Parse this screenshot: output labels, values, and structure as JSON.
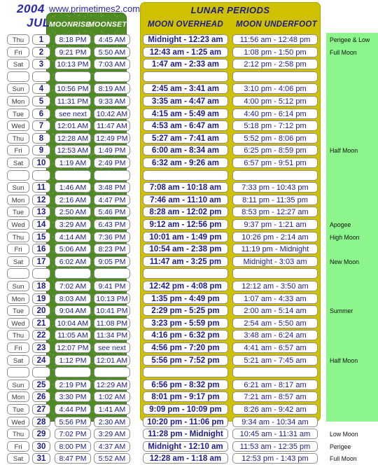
{
  "header": {
    "year": "2004",
    "site": "www.primetimes2.com",
    "month": "JUL",
    "lunar_periods_title": "LUNAR PERIODS",
    "col_moonrise": "MOONRISE",
    "col_moonset": "MOONSET",
    "col_overhead": "MOON OVERHEAD",
    "col_underfoot": "MOON UNDERFOOT"
  },
  "colors": {
    "green_panel": "#4e8b23",
    "yellow_panel": "#cfc100",
    "notes_panel": "#8cf58c",
    "text_blue": "#1c1c8c",
    "title_blue": "#2a2aa8"
  },
  "rows": [
    {
      "dow": "Thu",
      "day": "1",
      "rise": "8:18 PM",
      "set": "4:45 AM",
      "over": "Midnight - 12:23 am",
      "under": "11:56 am - 12:48 pm",
      "note": "Perigee & Low"
    },
    {
      "dow": "Fri",
      "day": "2",
      "rise": "9:21 PM",
      "set": "5:50 AM",
      "over": "12:43 am -  1:25 am",
      "under": "1:08 pm -  1:50 pm",
      "note": "Full Moon"
    },
    {
      "dow": "Sat",
      "day": "3",
      "rise": "10:13 PM",
      "set": "7:03 AM",
      "over": "1:47 am -  2:33 am",
      "under": "2:12 pm -  2:58 pm",
      "note": ""
    },
    {
      "dow": "",
      "day": "",
      "rise": "",
      "set": "",
      "over": "",
      "under": "",
      "note": "",
      "spacer": true
    },
    {
      "dow": "Sun",
      "day": "4",
      "rise": "10:56 PM",
      "set": "8:19 AM",
      "over": "2:45 am -  3:41 am",
      "under": "3:10 pm -  4:06 pm",
      "note": ""
    },
    {
      "dow": "Mon",
      "day": "5",
      "rise": "11:31 PM",
      "set": "9:33 AM",
      "over": "3:35 am -  4:47 am",
      "under": "4:00 pm -  5:12 pm",
      "note": ""
    },
    {
      "dow": "Tue",
      "day": "6",
      "rise": "see next",
      "set": "10:42 AM",
      "over": "4:15 am -  5:49 am",
      "under": "4:40 pm -  6:14 pm",
      "note": ""
    },
    {
      "dow": "Wed",
      "day": "7",
      "rise": "12:01 AM",
      "set": "11:47 AM",
      "over": "4:53 am -  6:47 am",
      "under": "5:18 pm -  7:12 pm",
      "note": ""
    },
    {
      "dow": "Thu",
      "day": "8",
      "rise": "12:28 AM",
      "set": "12:49 PM",
      "over": "5:27 am -  7:41 am",
      "under": "5:52 pm -  8:06 pm",
      "note": ""
    },
    {
      "dow": "Fri",
      "day": "9",
      "rise": "12:53 AM",
      "set": "1:49 PM",
      "over": "6:00 am -  8:34 am",
      "under": "6:25 pm -  8:59 pm",
      "note": "Half Moon"
    },
    {
      "dow": "Sat",
      "day": "10",
      "rise": "1:19 AM",
      "set": "2:49 PM",
      "over": "6:32 am -  9:26 am",
      "under": "6:57 pm -  9:51 pm",
      "note": ""
    },
    {
      "dow": "",
      "day": "",
      "rise": "",
      "set": "",
      "over": "",
      "under": "",
      "note": "",
      "spacer": true
    },
    {
      "dow": "Sun",
      "day": "11",
      "rise": "1:46 AM",
      "set": "3:48 PM",
      "over": "7:08 am - 10:18 am",
      "under": "7:33 pm - 10:43 pm",
      "note": ""
    },
    {
      "dow": "Mon",
      "day": "12",
      "rise": "2:16 AM",
      "set": "4:47 PM",
      "over": "7:46 am - 11:10 am",
      "under": "8:11 pm - 11:35 pm",
      "note": ""
    },
    {
      "dow": "Tue",
      "day": "13",
      "rise": "2:50 AM",
      "set": "5:46 PM",
      "over": "8:28 am - 12:02 pm",
      "under": "8:53 pm - 12:27 am",
      "note": ""
    },
    {
      "dow": "Wed",
      "day": "14",
      "rise": "3:29 AM",
      "set": "6:43 PM",
      "over": "9:12 am - 12:56 pm",
      "under": "9:37 pm -  1:21 am",
      "note": "Apogee"
    },
    {
      "dow": "Thu",
      "day": "15",
      "rise": "4:14 AM",
      "set": "7:36 PM",
      "over": "10:01 am -  1:49 pm",
      "under": "10:26 pm -  2:14 am",
      "note": "High Moon"
    },
    {
      "dow": "Fri",
      "day": "16",
      "rise": "5:06 AM",
      "set": "8:23 PM",
      "over": "10:54 am -  2:38 pm",
      "under": "11:19 pm - Midnight",
      "note": ""
    },
    {
      "dow": "Sat",
      "day": "17",
      "rise": "6:02 AM",
      "set": "9:05 PM",
      "over": "11:47 am -  3:25 pm",
      "under": "Midnight - 3:03 am",
      "note": "New Moon"
    },
    {
      "dow": "",
      "day": "",
      "rise": "",
      "set": "",
      "over": "",
      "under": "",
      "note": "",
      "spacer": true
    },
    {
      "dow": "Sun",
      "day": "18",
      "rise": "7:02 AM",
      "set": "9:41 PM",
      "over": "12:42 pm -  4:08 pm",
      "under": "12:12 am -  3:50 am",
      "note": ""
    },
    {
      "dow": "Mon",
      "day": "19",
      "rise": "8:03 AM",
      "set": "10:13 PM",
      "over": "1:35 pm -  4:49 pm",
      "under": "1:07 am -  4:33 am",
      "note": ""
    },
    {
      "dow": "Tue",
      "day": "20",
      "rise": "9:04 AM",
      "set": "10:41 PM",
      "over": "2:29 pm -  5:25 pm",
      "under": "2:00 am -  5:14 am",
      "note": "Summer"
    },
    {
      "dow": "Wed",
      "day": "21",
      "rise": "10:04 AM",
      "set": "11:08 PM",
      "over": "3:23 pm -  5:59 pm",
      "under": "2:54 am -  5:50 am",
      "note": ""
    },
    {
      "dow": "Thu",
      "day": "22",
      "rise": "11:05 AM",
      "set": "11:34 PM",
      "over": "4:16 pm -  6:32 pm",
      "under": "3:48 am -  6:24 am",
      "note": ""
    },
    {
      "dow": "Fri",
      "day": "23",
      "rise": "12:07 PM",
      "set": "see next",
      "over": "4:56 pm -  7:20 pm",
      "under": "4:41 am -  6:57 am",
      "note": ""
    },
    {
      "dow": "Sat",
      "day": "24",
      "rise": "1:12 PM",
      "set": "12:01 AM",
      "over": "5:56 pm -  7:52 pm",
      "under": "5:21 am -  7:45 am",
      "note": "Half Moon"
    },
    {
      "dow": "",
      "day": "",
      "rise": "",
      "set": "",
      "over": "",
      "under": "",
      "note": "",
      "spacer": true
    },
    {
      "dow": "Sun",
      "day": "25",
      "rise": "2:19 PM",
      "set": "12:29 AM",
      "over": "6:56 pm -  8:32 pm",
      "under": "6:21 am -  8:17 am",
      "note": ""
    },
    {
      "dow": "Mon",
      "day": "26",
      "rise": "3:30 PM",
      "set": "1:02 AM",
      "over": "8:01 pm -  9:17 pm",
      "under": "7:21 am -  8:57 am",
      "note": ""
    },
    {
      "dow": "Tue",
      "day": "27",
      "rise": "4:44 PM",
      "set": "1:41 AM",
      "over": "9:09 pm - 10:09 pm",
      "under": "8:26 am -  9:42 am",
      "note": ""
    },
    {
      "dow": "Wed",
      "day": "28",
      "rise": "5:56 PM",
      "set": "2:30 AM",
      "over": "10:20 pm - 11:06 pm",
      "under": "9:34 am - 10:34 am",
      "note": ""
    },
    {
      "dow": "Thu",
      "day": "29",
      "rise": "7:02 PM",
      "set": "3:29 AM",
      "over": "11:28 pm - Midnight",
      "under": "10:45 am - 11:31 am",
      "note": "Low Moon"
    },
    {
      "dow": "Fri",
      "day": "30",
      "rise": "8:00 PM",
      "set": "4:37 AM",
      "over": "Midnight - 12:10 am",
      "under": "11:53 am - 12:35 pm",
      "note": "Perigee"
    },
    {
      "dow": "Sat",
      "day": "31",
      "rise": "8:47 PM",
      "set": "5:52 AM",
      "over": "12:28 am -  1:18 am",
      "under": "12:53 pm -  1:43 pm",
      "note": "Full Moon"
    }
  ]
}
